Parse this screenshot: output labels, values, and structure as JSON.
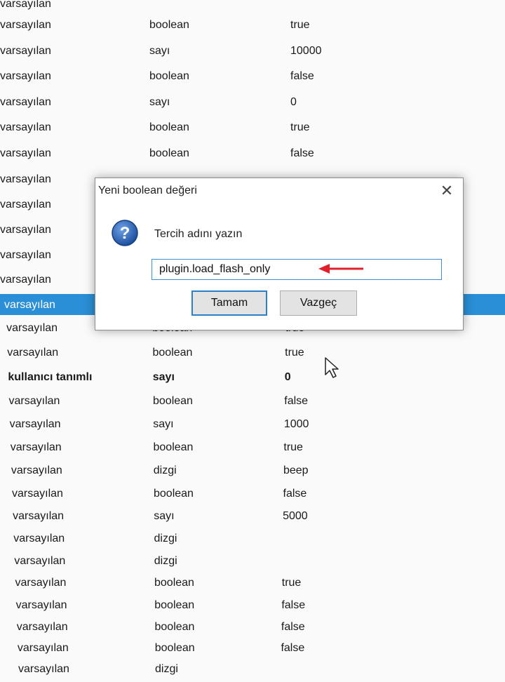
{
  "rows": [
    {
      "status": "varsayılan",
      "type": "",
      "value": ""
    },
    {
      "status": "varsayılan",
      "type": "boolean",
      "value": "true"
    },
    {
      "status": "varsayılan",
      "type": "sayı",
      "value": "10000"
    },
    {
      "status": "varsayılan",
      "type": "boolean",
      "value": "false"
    },
    {
      "status": "varsayılan",
      "type": "sayı",
      "value": "0"
    },
    {
      "status": "varsayılan",
      "type": "boolean",
      "value": "true"
    },
    {
      "status": "varsayılan",
      "type": "boolean",
      "value": "false"
    },
    {
      "status": "varsayılan",
      "type": "",
      "value": ""
    },
    {
      "status": "varsayılan",
      "type": "",
      "value": ""
    },
    {
      "status": "varsayılan",
      "type": "",
      "value": ""
    },
    {
      "status": "varsayılan",
      "type": "",
      "value": ""
    },
    {
      "status": "varsayılan",
      "type": "",
      "value": ""
    },
    {
      "status": "varsayılan",
      "type": "",
      "value": "",
      "selected": true
    },
    {
      "status": "varsayılan",
      "type": "boolean",
      "value": "true"
    },
    {
      "status": "varsayılan",
      "type": "boolean",
      "value": "true"
    },
    {
      "status": "kullanıcı tanımlı",
      "type": "sayı",
      "value": "0",
      "bold": true
    },
    {
      "status": "varsayılan",
      "type": "boolean",
      "value": "false"
    },
    {
      "status": "varsayılan",
      "type": "sayı",
      "value": "1000"
    },
    {
      "status": "varsayılan",
      "type": "boolean",
      "value": "true"
    },
    {
      "status": "varsayılan",
      "type": "dizgi",
      "value": "beep"
    },
    {
      "status": "varsayılan",
      "type": "boolean",
      "value": "false"
    },
    {
      "status": "varsayılan",
      "type": "sayı",
      "value": "5000"
    },
    {
      "status": "varsayılan",
      "type": "dizgi",
      "value": ""
    },
    {
      "status": "varsayılan",
      "type": "dizgi",
      "value": ""
    },
    {
      "status": "varsayılan",
      "type": "boolean",
      "value": "true"
    },
    {
      "status": "varsayılan",
      "type": "boolean",
      "value": "false"
    },
    {
      "status": "varsayılan",
      "type": "boolean",
      "value": "false"
    },
    {
      "status": "varsayılan",
      "type": "boolean",
      "value": "false"
    },
    {
      "status": "varsayılan",
      "type": "dizgi",
      "value": ""
    }
  ],
  "dialog": {
    "title": "Yeni boolean değeri",
    "close_icon": "close-icon",
    "question_icon": "question-icon",
    "prompt": "Tercih adını yazın",
    "input_value": "plugin.load_flash_only",
    "ok_label": "Tamam",
    "cancel_label": "Vazgeç",
    "accent_color": "#1f5fb0",
    "annotation_color": "#e0212b"
  },
  "colors": {
    "selection": "#2a8fd6",
    "background": "#fafafa"
  }
}
